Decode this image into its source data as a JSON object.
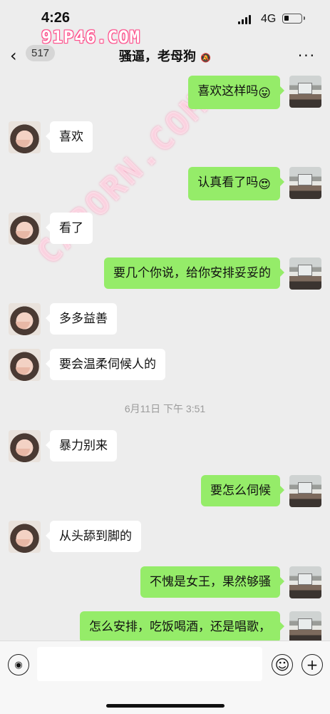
{
  "status": {
    "time": "4:26",
    "network": "4G",
    "battery_level": 0.3
  },
  "watermark": {
    "top": "91P46.COM",
    "diagonal": "CAPORN.COM"
  },
  "nav": {
    "back_icon": "‹",
    "unread_count": "517",
    "title": "骚逼，老母狗",
    "mute_icon": "🔕",
    "more_icon": "···"
  },
  "messages": [
    {
      "side": "out",
      "text": "喜欢这样吗",
      "emoji": "😛"
    },
    {
      "side": "in",
      "text": "喜欢"
    },
    {
      "side": "out",
      "text": "认真看了吗",
      "emoji": "😍"
    },
    {
      "side": "in",
      "text": "看了"
    },
    {
      "side": "out",
      "text": "要几个你说，给你安排妥妥的"
    },
    {
      "side": "in",
      "text": "多多益善"
    },
    {
      "side": "in",
      "text": "要会温柔伺候人的"
    },
    {
      "side": "in",
      "text": "暴力别来"
    },
    {
      "side": "out",
      "text": "要怎么伺候"
    },
    {
      "side": "in",
      "text": "从头舔到脚的"
    },
    {
      "side": "out",
      "text": "不愧是女王，果然够骚"
    },
    {
      "side": "out",
      "text": "怎么安排，吃饭喝酒，还是唱歌，"
    }
  ],
  "timestamp": "6月11日 下午 3:51",
  "input": {
    "voice_icon": "◉",
    "emoji_icon": "☺",
    "plus_icon": "+"
  }
}
